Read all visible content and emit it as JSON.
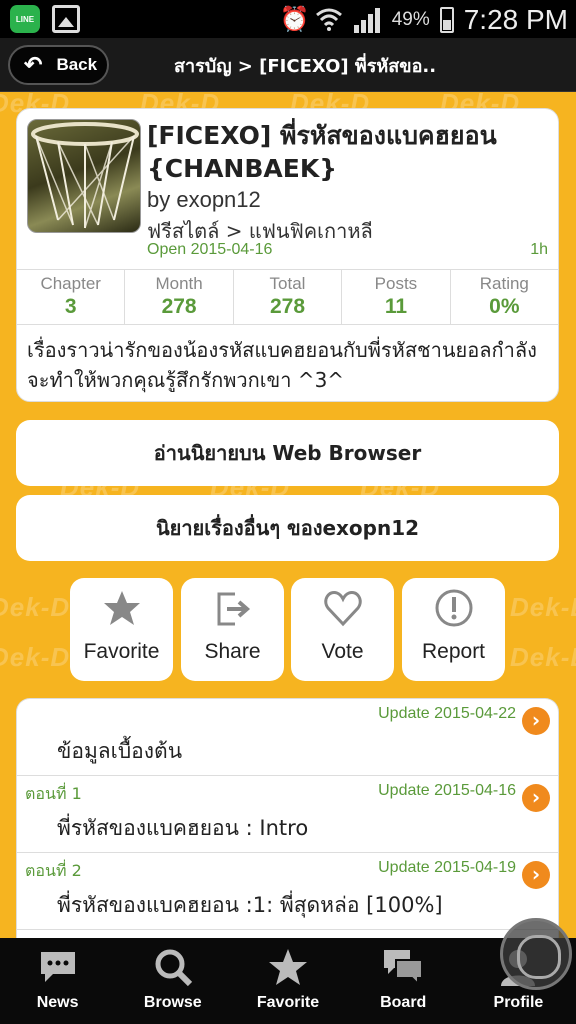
{
  "status_bar": {
    "battery_percent": "49%",
    "time": "7:28 PM",
    "line_app_label": "LINE"
  },
  "titlebar": {
    "back_label": "Back",
    "breadcrumb": "สารบัญ > [FICEXO] พี่รหัสขอ.."
  },
  "watermark": "Dek-D",
  "story": {
    "title": "[FICEXO] พี่รหัสของแบคฮยอน {CHANBAEK}",
    "author": "by exopn12",
    "category": "ฟรีสไตล์ > แฟนฟิคเกาหลี",
    "open_date": "Open 2015-04-16",
    "age": "1h",
    "stats": [
      {
        "label": "Chapter",
        "value": "3"
      },
      {
        "label": "Month",
        "value": "278"
      },
      {
        "label": "Total",
        "value": "278"
      },
      {
        "label": "Posts",
        "value": "11"
      },
      {
        "label": "Rating",
        "value": "0%"
      }
    ],
    "synopsis": "เรื่องราวน่ารักของน้องรหัสแบคฮยอนกับพี่รหัสชานยอลกำลังจะทำให้พวกคุณรู้สึกรักพวกเขา ^3^"
  },
  "buttons": {
    "read_web": "อ่านนิยายบน Web Browser",
    "other_stories": "นิยายเรื่องอื่นๆ ของexopn12"
  },
  "actions": [
    {
      "label": "Favorite",
      "icon": "star-icon"
    },
    {
      "label": "Share",
      "icon": "share-icon"
    },
    {
      "label": "Vote",
      "icon": "heart-icon"
    },
    {
      "label": "Report",
      "icon": "exclamation-icon"
    }
  ],
  "chapters": [
    {
      "number": "",
      "update": "Update 2015-04-22",
      "title": "ข้อมูลเบื้องต้น"
    },
    {
      "number": "ตอนที่ 1",
      "update": "Update 2015-04-16",
      "title": "พี่รหัสของแบคฮยอน : Intro"
    },
    {
      "number": "ตอนที่ 2",
      "update": "Update 2015-04-19",
      "title": "พี่รหัสของแบคฮยอน :1: พี่สุดหล่อ [100%]"
    }
  ],
  "bottom_nav": [
    {
      "label": "News",
      "icon": "news-icon"
    },
    {
      "label": "Browse",
      "icon": "search-icon"
    },
    {
      "label": "Favorite",
      "icon": "star-icon"
    },
    {
      "label": "Board",
      "icon": "board-icon"
    },
    {
      "label": "Profile",
      "icon": "profile-icon"
    }
  ],
  "colors": {
    "background": "#f6b420",
    "accent_green": "#5a9a3a",
    "arrow_orange": "#f08a1d"
  }
}
